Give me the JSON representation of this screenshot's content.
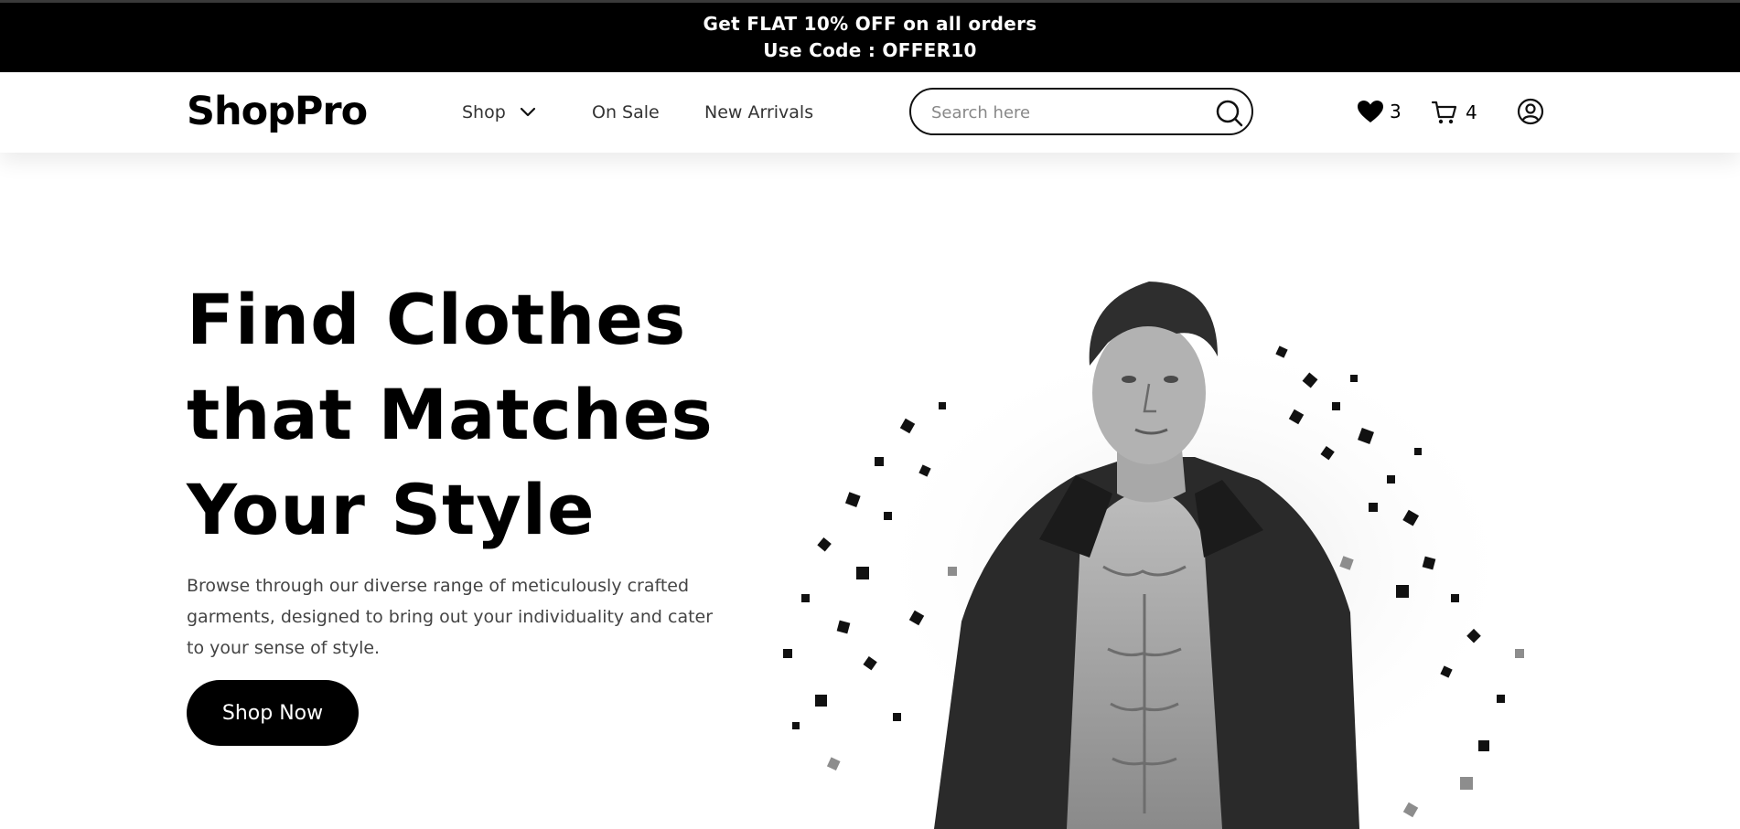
{
  "promo": {
    "line1": "Get FLAT 10% OFF on all orders",
    "line2": "Use Code : OFFER10"
  },
  "header": {
    "logo": "ShopPro",
    "nav": {
      "shop": "Shop",
      "on_sale": "On Sale",
      "new_arrivals": "New Arrivals"
    },
    "search": {
      "placeholder": "Search here",
      "value": ""
    },
    "wishlist_count": "3",
    "cart_count": "4"
  },
  "hero": {
    "title_lines": [
      "Find Clothes",
      "that Matches",
      "Your Style"
    ],
    "description": "Browse through our diverse range of meticulously crafted garments, designed to bring out your individuality and cater to your sense of style.",
    "cta": "Shop Now"
  },
  "icons": {
    "search": "search-icon",
    "chevron": "chevron-down-icon",
    "wishlist": "heart-icon",
    "cart": "cart-icon",
    "account": "user-icon"
  },
  "colors": {
    "promo_bg": "#000000",
    "accent": "#000000",
    "page_bg": "#ffffff"
  }
}
